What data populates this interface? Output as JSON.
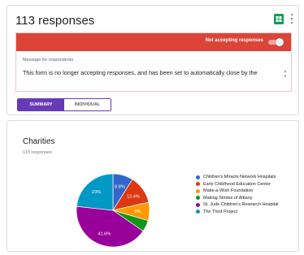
{
  "header": {
    "title": "113 responses"
  },
  "status_bar": {
    "label": "Not accepting responses",
    "accepting": false
  },
  "message": {
    "label": "Message for respondents",
    "text": "This form is no longer accepting responses, and has been set to automatically close by the"
  },
  "tabs": [
    {
      "label": "SUMMARY",
      "active": true
    },
    {
      "label": "INDIVIDUAL",
      "active": false
    }
  ],
  "question": {
    "title": "Charities",
    "count": "113 responses"
  },
  "colors": {
    "accent": "#673ab7",
    "alert": "#db4437",
    "sheets": "#0f9d58"
  },
  "chart_data": {
    "type": "pie",
    "slices": [
      {
        "name": "Children's Miracle Network Hospitals",
        "value": 8.8,
        "label": "8.8%",
        "color": "#3366cc"
      },
      {
        "name": "Early Childhood Education Center",
        "value": 12.4,
        "label": "12.4%",
        "color": "#dc3912"
      },
      {
        "name": "Make-a-Wish Foundation",
        "value": 8,
        "label": "8%",
        "color": "#ff9900"
      },
      {
        "name": "Making Strides of Albany",
        "value": 5,
        "label": "",
        "color": "#109618"
      },
      {
        "name": "St. Jude Children's Research Hospital",
        "value": 41.6,
        "label": "41.6%",
        "color": "#990099"
      },
      {
        "name": "The Third Project",
        "value": 23,
        "label": "23%",
        "color": "#0099c6"
      }
    ],
    "legend_position": "right"
  }
}
